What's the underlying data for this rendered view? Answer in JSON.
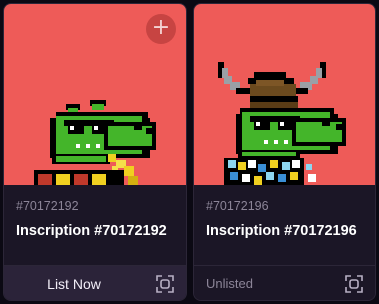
{
  "cards": [
    {
      "number": "#70172192",
      "title": "Inscription #70172192",
      "action": "List Now",
      "add_icon": "plus-icon",
      "expand_icon": "expand-icon"
    },
    {
      "number": "#70172196",
      "title": "Inscription #70172196",
      "status": "Unlisted",
      "expand_icon": "expand-icon"
    }
  ],
  "colors": {
    "art_background": "#ee5b58",
    "card_background": "#1b1626",
    "page_background": "#0b0913",
    "croc_green": "#44b52a"
  }
}
